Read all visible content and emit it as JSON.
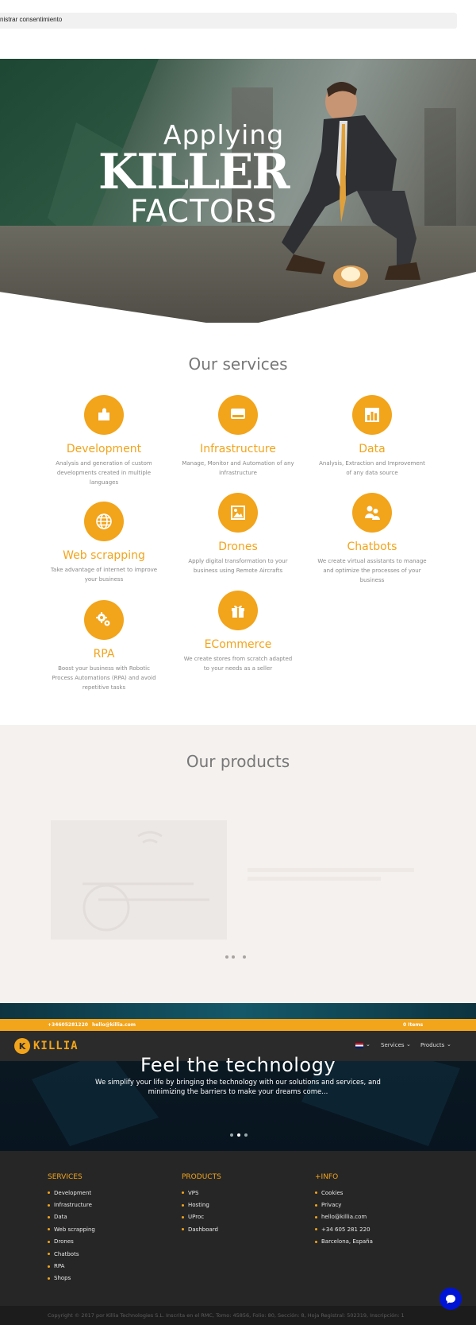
{
  "consent": {
    "text": "nistrar consentimiento"
  },
  "hero": {
    "line1": "Applying",
    "line2": "KILLER",
    "line3": "FACTORS"
  },
  "services": {
    "title": "Our services",
    "items": [
      {
        "name": "Development",
        "desc": "Analysis and generation of custom developments created in multiple languages",
        "icon": "puzzle-icon"
      },
      {
        "name": "Infrastructure",
        "desc": "Manage, Monitor and Automation of any infrastructure",
        "icon": "server-icon"
      },
      {
        "name": "Data",
        "desc": "Analysis, Extraction and Improvement of any data source",
        "icon": "bar-chart-icon"
      },
      {
        "name": "Web scrapping",
        "desc": "Take advantage of internet to improve your business",
        "icon": "globe-icon"
      },
      {
        "name": "Drones",
        "desc": "Apply digital transformation to your business using Remote Aircrafts",
        "icon": "image-icon"
      },
      {
        "name": "Chatbots",
        "desc": "We create virtual assistants to manage and optimize the processes of your business",
        "icon": "users-icon"
      },
      {
        "name": "RPA",
        "desc": "Boost your business with Robotic Process Automations (RPA) and avoid repetitive tasks",
        "icon": "gears-icon"
      },
      {
        "name": "ECommerce",
        "desc": "We create stores from scratch adapted to your needs as a seller",
        "icon": "gift-icon"
      }
    ]
  },
  "products": {
    "title": "Our products"
  },
  "topbar": {
    "phone": "+34605281220",
    "email": "hello@killia.com",
    "cart": "0 Items"
  },
  "nav": {
    "brand": "KILLIA",
    "logo_letter": "K",
    "services": "Services",
    "products": "Products"
  },
  "feel": {
    "title": "Feel the technology",
    "subtitle": "We simplify your life by bringing the technology with our solutions and services, and minimizing the barriers to make your dreams come..."
  },
  "footer": {
    "services_title": "SERVICES",
    "services": [
      "Development",
      "Infrastructure",
      "Data",
      "Web scrapping",
      "Drones",
      "Chatbots",
      "RPA",
      "Shops"
    ],
    "products_title": "PRODUCTS",
    "products": [
      "VPS",
      "Hosting",
      "UProc",
      "Dashboard"
    ],
    "info_title": "+INFO",
    "info": [
      "Cookies",
      "Privacy",
      "hello@killia.com",
      "+34 605 281 220",
      "Barcelona, España"
    ]
  },
  "copyright": "Copyright © 2017 por Killia Technologies S.L. Inscrita en el RMC, Tomo: 45856, Folio: 80, Sección: 8, Hoja Registral: 502319, Inscripción: 1",
  "colors": {
    "accent": "#f2a41b",
    "footer_bg": "#262626",
    "chat": "#0014d6"
  }
}
